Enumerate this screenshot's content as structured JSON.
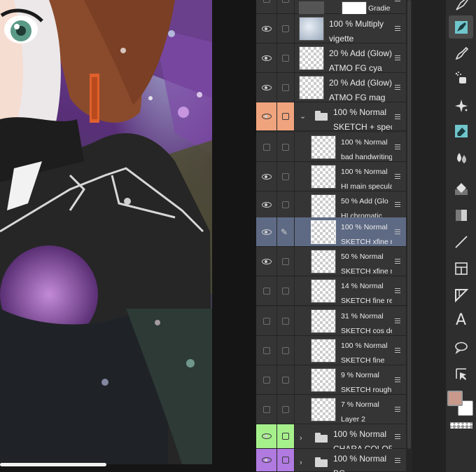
{
  "layers": [
    {
      "mode": "",
      "name": "Gradie",
      "visible": false,
      "folder": false,
      "thumb": "gradient",
      "small": true
    },
    {
      "mode": "100 % Multiply",
      "name": "vigette",
      "visible": true,
      "folder": false,
      "thumb": "vignette",
      "small": false
    },
    {
      "mode": "20 % Add (Glow)",
      "name": "ATMO FG cya",
      "visible": true,
      "folder": false,
      "thumb": "transparent",
      "small": false
    },
    {
      "mode": "20 % Add (Glow)",
      "name": "ATMO FG mag",
      "visible": true,
      "folder": false,
      "thumb": "transparent",
      "small": false
    },
    {
      "mode": "100 % Normal",
      "name": "SKETCH + spec",
      "visible": true,
      "folder": true,
      "open": true,
      "color": "#f0a47e",
      "small": false
    },
    {
      "mode": "100 % Normal",
      "name": "bad handwriting",
      "visible": false,
      "folder": false,
      "thumb": "transparent",
      "small": true,
      "indent": true
    },
    {
      "mode": "100 % Normal",
      "name": "HI main specular",
      "visible": true,
      "folder": false,
      "thumb": "transparent",
      "small": true,
      "indent": true
    },
    {
      "mode": "50 % Add (Glo",
      "name": "HI chromatic",
      "visible": true,
      "folder": false,
      "thumb": "transparent",
      "small": true,
      "indent": true
    },
    {
      "mode": "100 % Normal",
      "name": "SKETCH xfine ma",
      "visible": true,
      "folder": false,
      "thumb": "transparent",
      "small": true,
      "indent": true,
      "selected": true,
      "editing": true
    },
    {
      "mode": "50 % Normal",
      "name": "SKETCH xfine ma",
      "visible": true,
      "folder": false,
      "thumb": "transparent",
      "small": true,
      "indent": true
    },
    {
      "mode": "14 % Normal",
      "name": "SKETCH fine resiz",
      "visible": false,
      "folder": false,
      "thumb": "transparent",
      "small": true,
      "indent": true
    },
    {
      "mode": "31 % Normal",
      "name": "SKETCH cos detai",
      "visible": false,
      "folder": false,
      "thumb": "transparent",
      "small": true,
      "indent": true
    },
    {
      "mode": "100 % Normal",
      "name": "SKETCH fine",
      "visible": false,
      "folder": false,
      "thumb": "transparent",
      "small": true,
      "indent": true
    },
    {
      "mode": "9 % Normal",
      "name": "SKETCH rough",
      "visible": false,
      "folder": false,
      "thumb": "transparent",
      "small": true,
      "indent": true
    },
    {
      "mode": "7 % Normal",
      "name": "Layer 2",
      "visible": false,
      "folder": false,
      "thumb": "transparent",
      "small": true,
      "indent": true
    },
    {
      "mode": "100 % Normal",
      "name": "CHARA COLOR",
      "visible": true,
      "folder": true,
      "open": false,
      "color": "#a6f08c",
      "small": false
    },
    {
      "mode": "100 % Normal",
      "name": "BG",
      "visible": true,
      "folder": true,
      "open": false,
      "color": "#b07ae0",
      "small": false
    }
  ],
  "tools": [
    {
      "icon": "pen-nib-icon"
    },
    {
      "icon": "marker-pen-icon",
      "active": true
    },
    {
      "icon": "brush-icon"
    },
    {
      "icon": "airbrush-icon"
    },
    {
      "icon": "sparkle-icon"
    },
    {
      "icon": "eraser-icon"
    },
    {
      "icon": "blend-drop-icon"
    },
    {
      "icon": "fill-bucket-icon"
    },
    {
      "icon": "gradient-icon"
    },
    {
      "icon": "line-icon"
    },
    {
      "icon": "frame-icon"
    },
    {
      "icon": "ruler-triangle-icon"
    },
    {
      "icon": "text-icon",
      "letter": "A"
    },
    {
      "icon": "speech-balloon-icon"
    },
    {
      "icon": "selection-pointer-icon"
    }
  ],
  "colors": {
    "foreground": "#c99a8c",
    "background": "#ffffff",
    "selected_row": "#5e6a84"
  }
}
